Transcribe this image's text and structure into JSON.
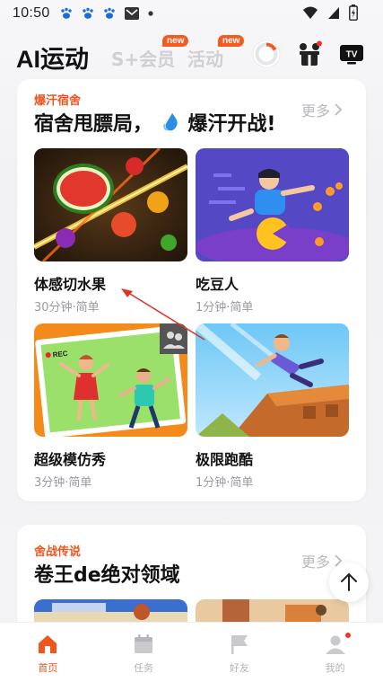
{
  "status_bar": {
    "time": "10:50"
  },
  "header": {
    "brand": "AI运动",
    "tabs": [
      {
        "label": "S+会员",
        "badge": "new"
      },
      {
        "label": "活动",
        "badge": "new"
      }
    ],
    "icons": [
      "progress-ring-icon",
      "gift-people-icon",
      "tv-icon"
    ]
  },
  "section1": {
    "tag": "爆汗宿舍",
    "title_part1": "宿舍甩膘局，",
    "title_part2": "爆汗开战!",
    "more_label": "更多",
    "games": [
      {
        "name": "体感切水果",
        "meta": "30分钟·简单",
        "thumb": "fruit-ninja"
      },
      {
        "name": "吃豆人",
        "meta": "1分钟·简单",
        "thumb": "pacman"
      },
      {
        "name": "超级模仿秀",
        "meta": "3分钟·简单",
        "thumb": "imitation",
        "thumb_badge": "REC"
      },
      {
        "name": "极限跑酷",
        "meta": "1分钟·简单",
        "thumb": "parkour"
      }
    ]
  },
  "section2": {
    "tag": "舍战传说",
    "title": "卷王de绝对领域",
    "more_label": "更多"
  },
  "bottom_nav": [
    {
      "label": "首页",
      "active": true
    },
    {
      "label": "任务",
      "active": false
    },
    {
      "label": "好友",
      "active": false
    },
    {
      "label": "我的",
      "active": false,
      "dot": true
    }
  ],
  "colors": {
    "accent": "#f2541e",
    "inactive": "#b3b3b8",
    "badge": "#f25c23"
  }
}
